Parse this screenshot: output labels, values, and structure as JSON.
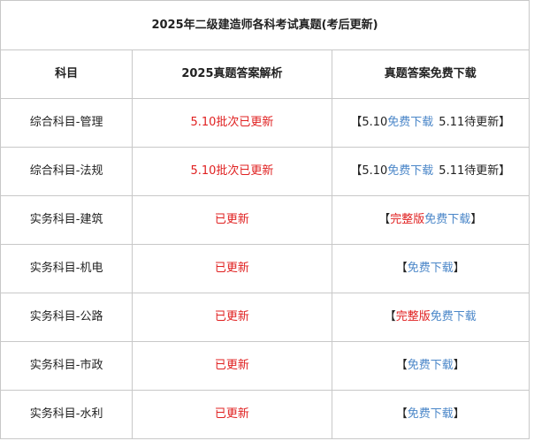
{
  "table": {
    "title": "2025年二级建造师各科考试真题(考后更新)",
    "headers": [
      "科目",
      "2025真题答案解析",
      "真题答案免费下载"
    ],
    "rows": [
      {
        "subject": "综合科目-管理",
        "analysis": "5.10批次已更新",
        "download": {
          "open": "【",
          "date1": "5.10",
          "link": "免费下载",
          "date2": "5.11",
          "status": "待更新",
          "close": "】"
        }
      },
      {
        "subject": "综合科目-法规",
        "analysis": "5.10批次已更新",
        "download": {
          "open": "【",
          "date1": "5.10",
          "link": "免费下载",
          "date2": "5.11",
          "status": "待更新",
          "close": "】"
        }
      },
      {
        "subject": "实务科目-建筑",
        "analysis": "已更新",
        "download": {
          "open": "【",
          "full": "完整版",
          "link": "免费下载",
          "close": "】"
        }
      },
      {
        "subject": "实务科目-机电",
        "analysis": "已更新",
        "download": {
          "open": "【",
          "link": "免费下载",
          "close": "】"
        }
      },
      {
        "subject": "实务科目-公路",
        "analysis": "已更新",
        "download": {
          "open": "【",
          "full": "完整版",
          "link": "免费下载"
        }
      },
      {
        "subject": "实务科目-市政",
        "analysis": "已更新",
        "download": {
          "open": "【",
          "link": "免费下载",
          "close": "】"
        }
      },
      {
        "subject": "实务科目-水利",
        "analysis": "已更新",
        "download": {
          "open": "【",
          "link": "免费下载",
          "close": "】"
        }
      }
    ]
  },
  "colors": {
    "border": "#c8c8c8",
    "updated_text": "#e02020",
    "link_text": "#4a86c8",
    "body_text": "#222222"
  }
}
